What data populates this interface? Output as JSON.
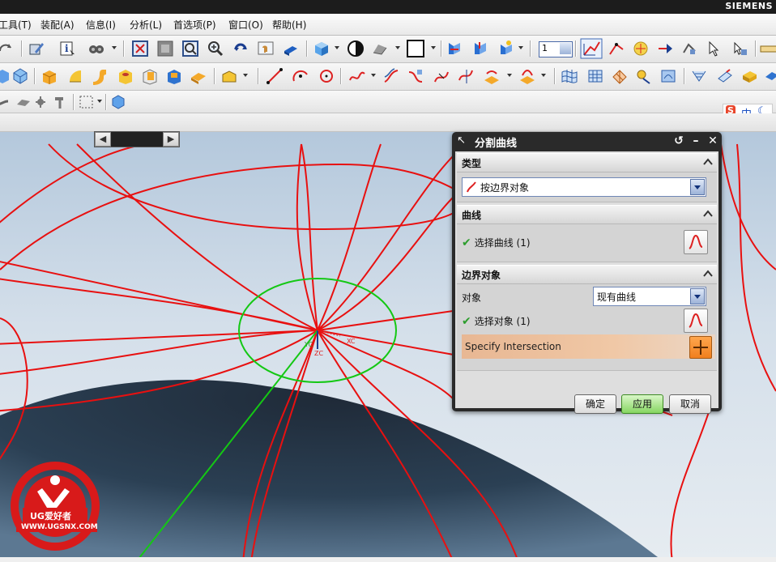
{
  "titlebar": {
    "brand": "SIEMENS"
  },
  "menu": {
    "items": [
      "工具(T)",
      "装配(A)",
      "信息(I)",
      "分析(L)",
      "首选项(P)",
      "窗口(O)",
      "帮助(H)"
    ]
  },
  "toolbar": {
    "layer_value": "1"
  },
  "ime": {
    "mode_s": "S",
    "mode_zh": "中"
  },
  "viewport": {
    "axis_labels": {
      "xc": "XC",
      "yc": "YC",
      "zc": "ZC"
    },
    "logo_brand": "UG爱好者",
    "logo_url": "WWW.UGSNX.COM"
  },
  "dialog": {
    "title": "分割曲线",
    "sections": {
      "type": {
        "header": "类型",
        "value": "按边界对象"
      },
      "curve": {
        "header": "曲线",
        "select_label": "选择曲线 (1)"
      },
      "boundary": {
        "header": "边界对象",
        "object_label": "对象",
        "object_value": "现有曲线",
        "select_label": "选择对象 (1)",
        "specify_label": "Specify Intersection"
      }
    },
    "buttons": {
      "ok": "确定",
      "apply": "应用",
      "cancel": "取消"
    }
  },
  "colors": {
    "curve_red": "#e81010",
    "circle_green": "#14c814",
    "surface_dark": "#26374a",
    "dialog_frame": "#2a2a2a",
    "specify_orange": "#f08a2a"
  }
}
